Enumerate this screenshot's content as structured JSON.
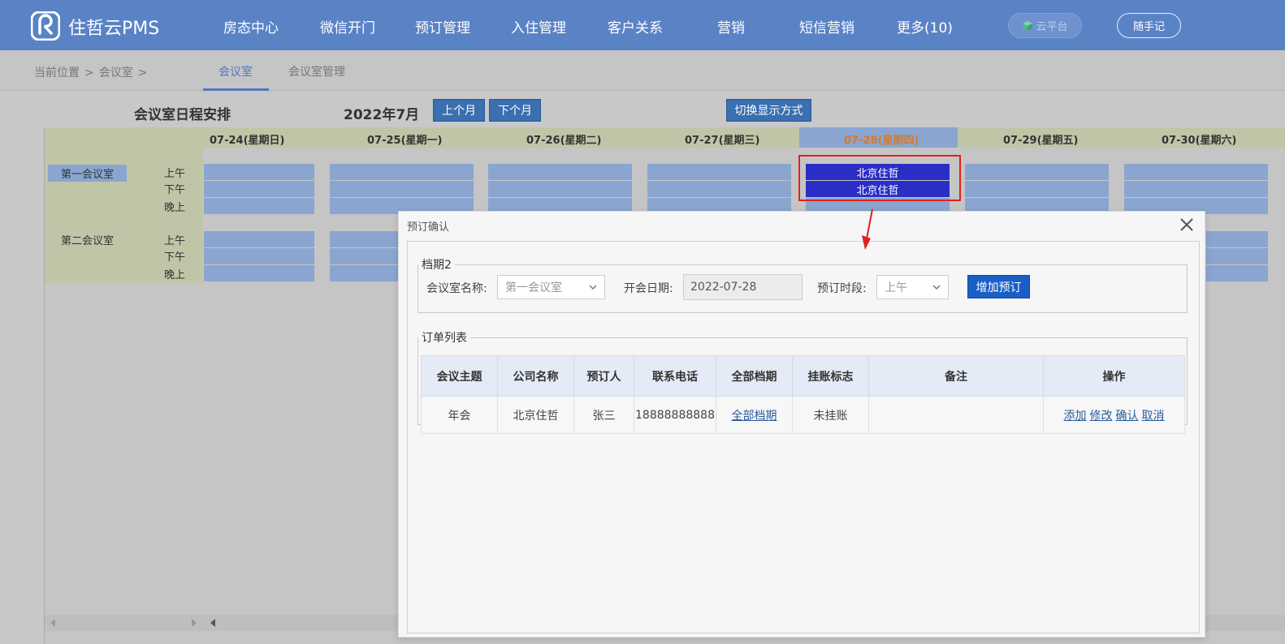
{
  "header": {
    "brand": "住哲云PMS",
    "nav": [
      "房态中心",
      "微信开门",
      "预订管理",
      "入住管理",
      "客户关系",
      "营销",
      "短信营销",
      "更多(10)"
    ],
    "cloud_label": "云平台",
    "note_label": "随手记"
  },
  "breadcrumb": {
    "prefix": "当前位置",
    "sep": ">",
    "current": "会议室",
    "trail": ">"
  },
  "subtabs": [
    "会议室",
    "会议室管理"
  ],
  "schedule": {
    "title": "会议室日程安排",
    "month": "2022年7月",
    "prev_label": "上个月",
    "next_label": "下个月",
    "toggle_label": "切换显示方式",
    "days": [
      "07-24(星期日)",
      "07-25(星期一)",
      "07-26(星期二)",
      "07-27(星期三)",
      "07-28(星期四)",
      "07-29(星期五)",
      "07-30(星期六)"
    ],
    "highlight_day": "07-28(星期四)",
    "rooms": [
      {
        "name": "第一会议室",
        "slots": [
          "上午",
          "下午",
          "晚上"
        ],
        "bookings": [
          {
            "day": "07-28(星期四)",
            "slot": "上午",
            "text": "北京住哲"
          },
          {
            "day": "07-28(星期四)",
            "slot": "下午",
            "text": "北京住哲"
          }
        ]
      },
      {
        "name": "第二会议室",
        "slots": [
          "上午",
          "下午",
          "晚上"
        ],
        "bookings": []
      }
    ]
  },
  "modal": {
    "title": "预订确认",
    "form": {
      "legend": "档期2",
      "room_label": "会议室名称:",
      "room_value": "第一会议室",
      "date_label": "开会日期:",
      "date_value": "2022-07-28",
      "period_label": "预订时段:",
      "period_value": "上午",
      "add_button": "增加预订"
    },
    "orders": {
      "legend": "订单列表",
      "columns": [
        "会议主题",
        "公司名称",
        "预订人",
        "联系电话",
        "全部档期",
        "挂账标志",
        "备注",
        "操作"
      ],
      "rows": [
        {
          "topic": "年会",
          "company": "北京住哲",
          "booker": "张三",
          "phone": "18888888888",
          "all_periods": "全部档期",
          "credit_flag": "未挂账",
          "remark": ""
        }
      ],
      "actions": [
        "添加",
        "修改",
        "确认",
        "取消"
      ]
    }
  },
  "colors": {
    "topbar": "#5a83c6",
    "cell": "#8aa6d0",
    "booked": "#2b2ec5",
    "highlight_box": "#e02020",
    "primary_button": "#1a5fc7"
  }
}
